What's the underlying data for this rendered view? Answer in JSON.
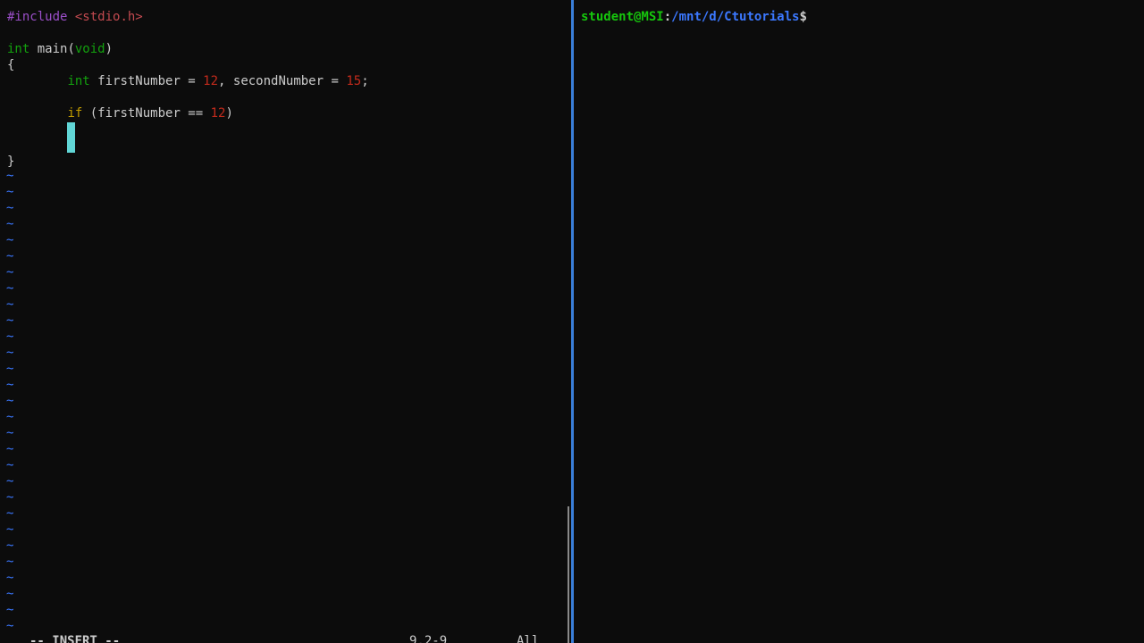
{
  "colors": {
    "background": "#0c0c0c",
    "preprocessor": "#9b4fc9",
    "include_path": "#c34a50",
    "type_keyword": "#13a10e",
    "number_literal": "#c42b1c",
    "control_keyword": "#c19c00",
    "default_text": "#cccccc",
    "tilde": "#3b78ff",
    "cursor": "#61d6d6",
    "prompt_user": "#16c60c",
    "prompt_path": "#3b78ff",
    "divider": "#3a7fd9"
  },
  "editor": {
    "code": {
      "include_directive": "#include",
      "include_file": "<stdio.h>",
      "main_type": "int",
      "main_name": " main(",
      "main_param": "void",
      "main_close": ")",
      "open_brace": "{",
      "decl_indent": "        ",
      "decl_type": "int",
      "decl_var1": " firstNumber = ",
      "decl_val1": "12",
      "decl_mid": ", secondNumber = ",
      "decl_val2": "15",
      "decl_end": ";",
      "if_indent": "        ",
      "if_keyword": "if",
      "if_cond": " (firstNumber == ",
      "if_val": "12",
      "if_close": ")",
      "cursor_indent": "        ",
      "close_brace": "}"
    },
    "empty_line_marker": "~",
    "empty_line_count": 29,
    "status": {
      "mode": "-- INSERT --",
      "position": "9,2-9",
      "percent": "All"
    },
    "cursor_icon": "block-cursor-icon"
  },
  "terminal": {
    "prompt": {
      "user_host": "student@MSI",
      "separator": ":",
      "path": "/mnt/d/Ctutorials",
      "symbol": "$"
    }
  }
}
